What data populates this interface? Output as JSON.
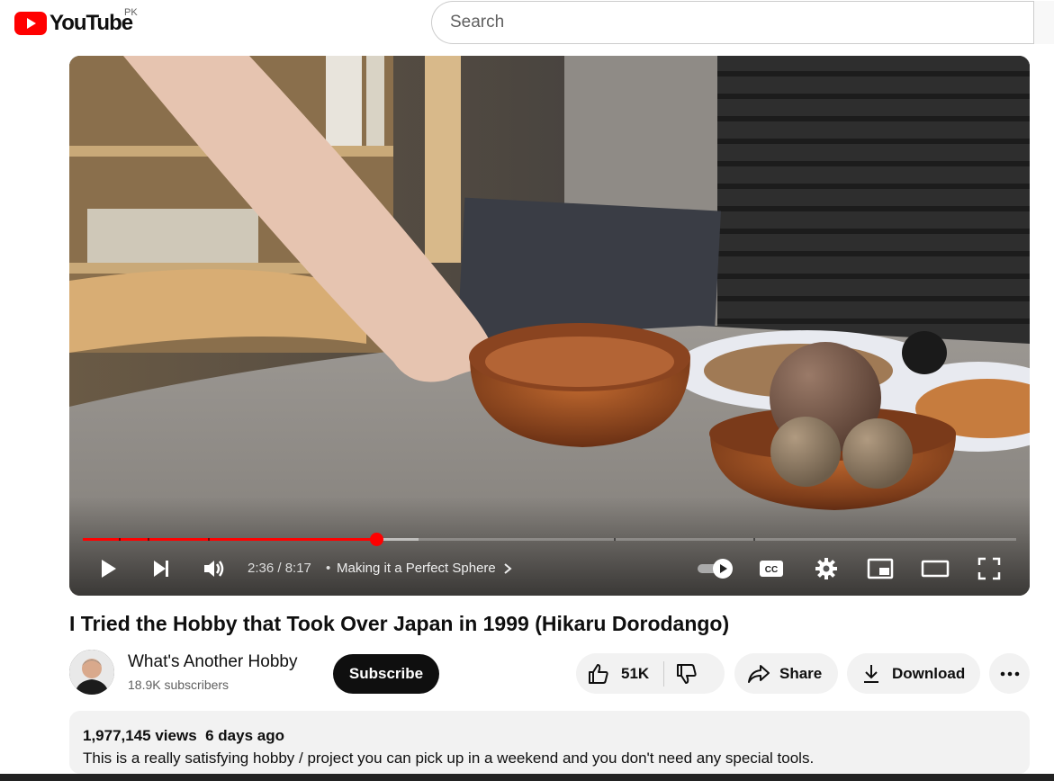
{
  "header": {
    "logo_text": "YouTube",
    "country_code": "PK",
    "search_placeholder": "Search"
  },
  "player": {
    "current_time": "2:36",
    "duration": "8:17",
    "time_display": "2:36 / 8:17",
    "chapter_title": "Making it a Perfect Sphere",
    "progress_fraction": 0.314,
    "buffered_fraction": 0.36,
    "autoplay_on": true,
    "accent_color": "#ff0000"
  },
  "video": {
    "title": "I Tried the Hobby that Took Over Japan in 1999 (Hikaru Dorodango)"
  },
  "channel": {
    "name": "What's Another Hobby",
    "subscribers": "18.9K subscribers",
    "subscribe_label": "Subscribe"
  },
  "actions": {
    "likes": "51K",
    "share_label": "Share",
    "download_label": "Download"
  },
  "description": {
    "views": "1,977,145 views",
    "age": "6 days ago",
    "text": "This is a really satisfying hobby / project you can pick up in a weekend and you don't need any special tools."
  }
}
